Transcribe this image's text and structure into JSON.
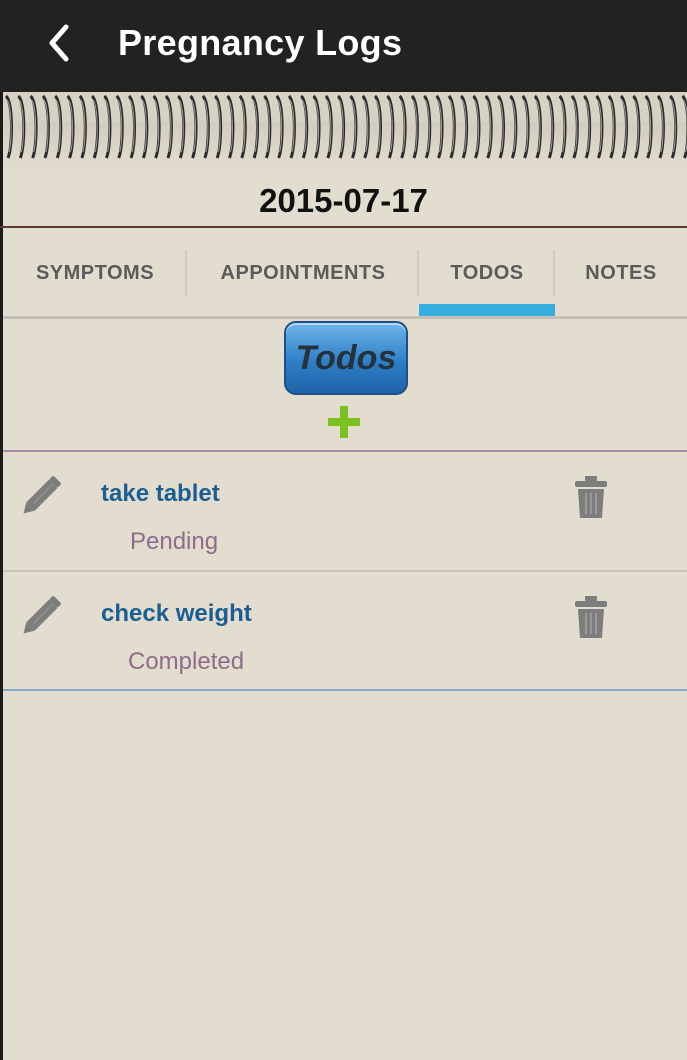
{
  "header": {
    "title": "Pregnancy Logs",
    "back_icon": "chevron-left-icon"
  },
  "date": "2015-07-17",
  "tabs": [
    {
      "label": "SYMPTOMS",
      "active": false
    },
    {
      "label": "APPOINTMENTS",
      "active": false
    },
    {
      "label": "TODOS",
      "active": true
    },
    {
      "label": "NOTES",
      "active": false
    }
  ],
  "section": {
    "label": "Todos",
    "add_icon": "plus-icon"
  },
  "todos": [
    {
      "name": "take tablet",
      "status": "Pending",
      "edit_icon": "pencil-icon",
      "delete_icon": "trash-icon"
    },
    {
      "name": "check weight",
      "status": "Completed",
      "edit_icon": "pencil-icon",
      "delete_icon": "trash-icon"
    }
  ],
  "colors": {
    "topbar": "#222222",
    "background": "#e3ddd0",
    "tab_indicator": "#34aee0",
    "todo_name": "#1b5e94",
    "todo_status": "#8e6d8c",
    "add": "#7cc21e"
  }
}
